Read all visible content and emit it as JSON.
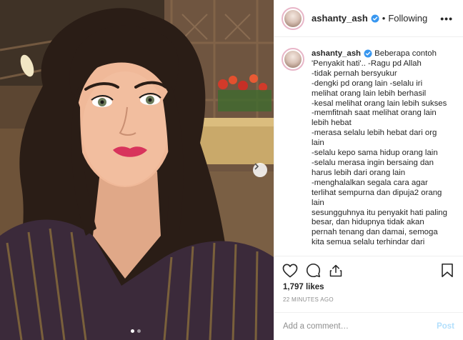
{
  "post": {
    "username": "ashanty_ash",
    "separator": "•",
    "follow_status": "Following",
    "more_label": "•••",
    "caption_username": "ashanty_ash",
    "caption_text": " Beberapa contoh\n'Penyakit hati'.. -Ragu pd Allah\n-tidak pernah bersyukur\n-dengki pd orang lain -selalu iri\nmelihat orang lain lebih berhasil\n-kesal melihat orang lain lebih sukses\n-memfitnah saat melihat orang lain\nlebih hebat\n-merasa selalu lebih hebat dari org\nlain\n-selalu kepo sama hidup orang lain\n-selalu merasa ingin bersaing dan\nharus lebih dari orang lain\n-menghalalkan segala cara agar\nterlihat sempurna dan dipuja2 orang\nlain\nsesungguhnya itu penyakit hati paling\nbesar, dan hidupnya tidak akan\npernah tenang dan damai, semoga\nkita semua selalu terhindar dari",
    "likes": "1,797 likes",
    "time_ago": "22 MINUTES AGO",
    "comment_placeholder": "Add a comment…",
    "post_label": "Post"
  },
  "carousel": {
    "total_slides": 2,
    "active_slide": 1
  },
  "icons": {
    "verified": "verified-badge-icon",
    "like": "heart-icon",
    "comment": "comment-icon",
    "share": "share-icon",
    "save": "bookmark-icon",
    "next": "chevron-right-icon"
  },
  "colors": {
    "verified": "#3897f0",
    "post_button_disabled": "#b2dffc",
    "muted_text": "#8e8e8e",
    "border": "#efefef"
  }
}
